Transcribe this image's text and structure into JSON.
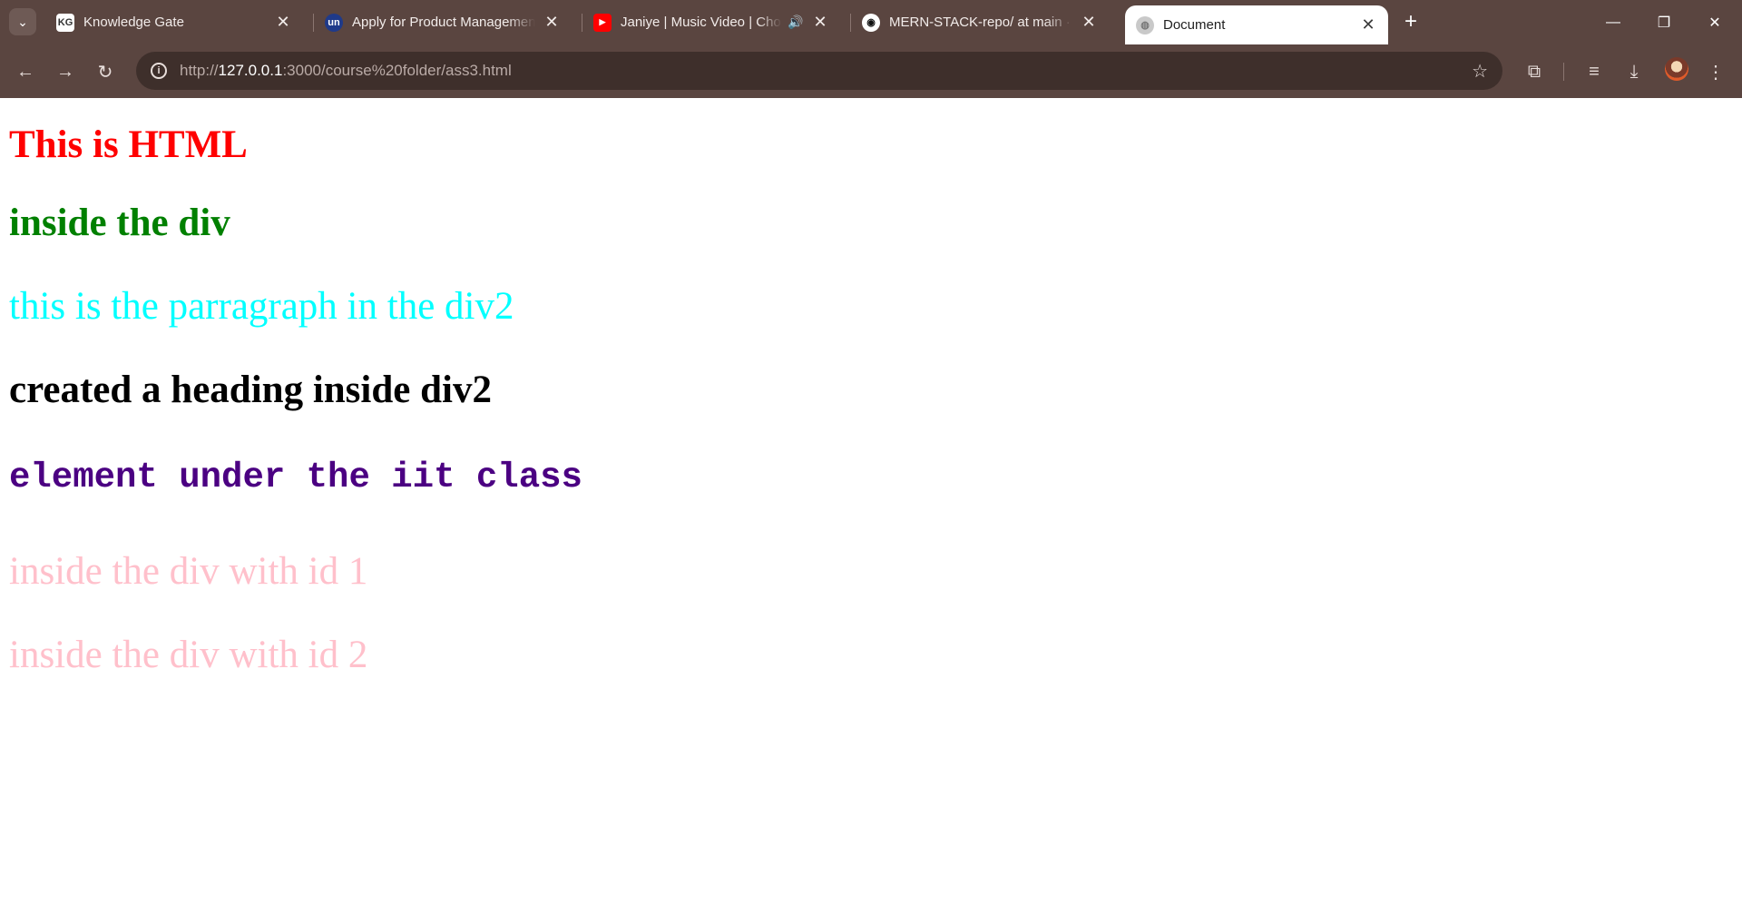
{
  "browser": {
    "tabs": [
      {
        "favicon": "KG",
        "title": "Knowledge Gate",
        "close": "✕"
      },
      {
        "favicon": "un",
        "title": "Apply for Product Management",
        "close": "✕"
      },
      {
        "favicon": "▶",
        "title": "Janiye | Music Video | Chor Bazaar",
        "close": "✕",
        "audio": "🔊"
      },
      {
        "favicon": "◉",
        "title": "MERN-STACK-repo/ at main · n",
        "close": "✕"
      },
      {
        "favicon": "◍",
        "title": "Document",
        "close": "✕"
      }
    ],
    "new_tab": "+",
    "window_controls": {
      "minimize": "—",
      "restore": "❐",
      "close": "✕"
    },
    "toolbar": {
      "back": "←",
      "forward": "→",
      "reload": "↻",
      "url_prefix": "http://",
      "url_host": "127.0.0.1",
      "url_rest": ":3000/course%20folder/ass3.html",
      "star": "☆",
      "extensions": "⧉",
      "media": "≡",
      "download": "⤓",
      "menu": "⋮"
    },
    "colors": {
      "frame": "#5a4540",
      "omnibox": "#3e2f2b",
      "active_tab": "#ffffff"
    }
  },
  "page": {
    "lines": [
      {
        "text": "This is HTML",
        "color": "#ff0000"
      },
      {
        "text": "inside the div",
        "color": "#008000"
      },
      {
        "text": "this is the parragraph in the div2",
        "color": "#00ffff"
      },
      {
        "text": "created a heading inside div2",
        "color": "#000000"
      },
      {
        "text": "element under the iit class",
        "color": "#4b0082"
      },
      {
        "text": "inside the div with id 1",
        "color": "#ffc0cb"
      },
      {
        "text": "inside the div with id 2",
        "color": "#ffc0cb"
      }
    ]
  }
}
